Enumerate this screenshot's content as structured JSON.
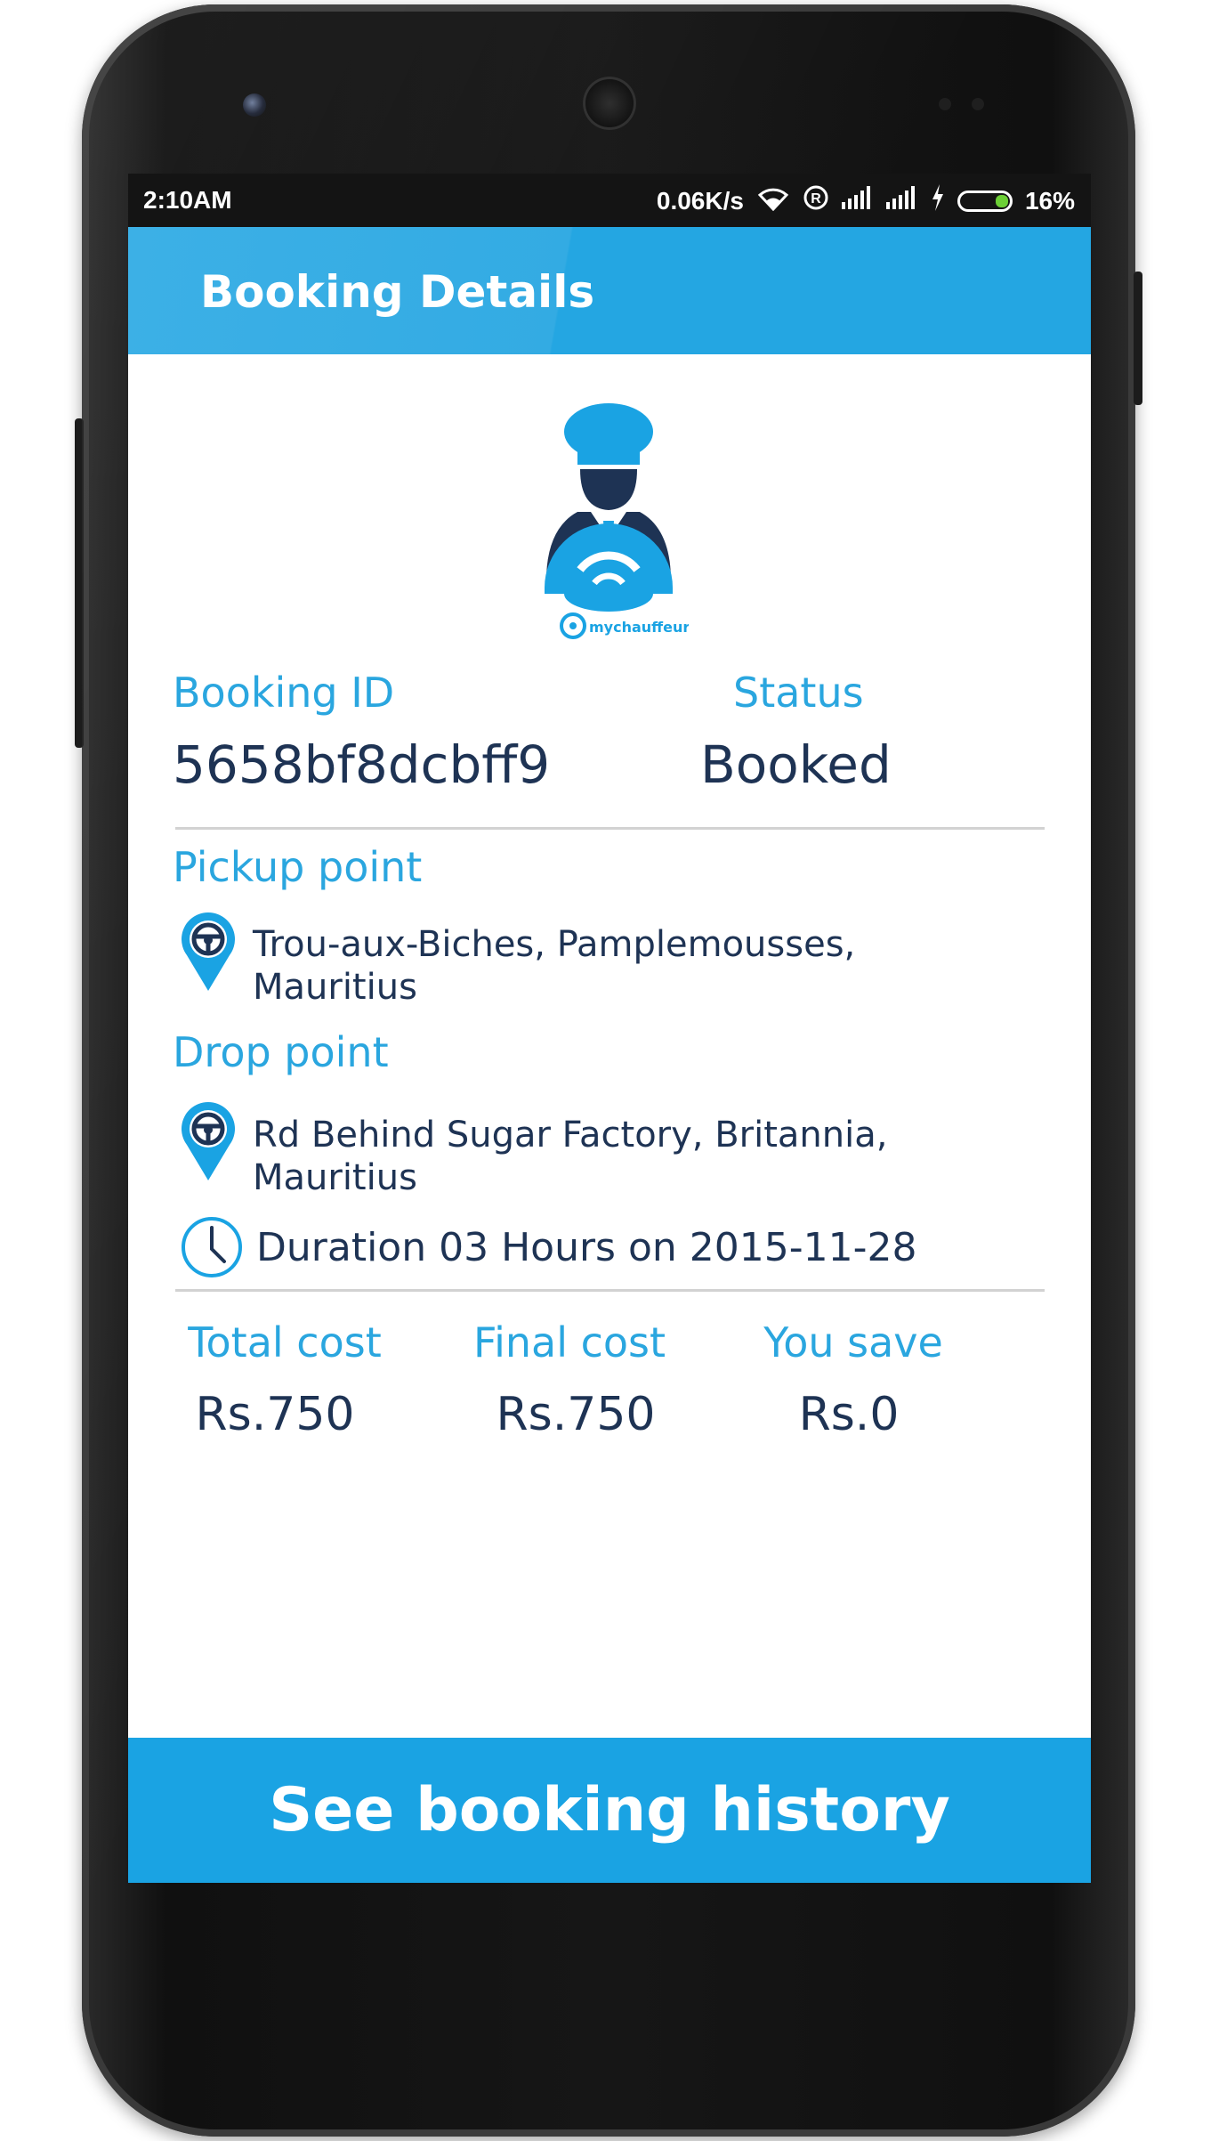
{
  "status_bar": {
    "time": "2:10AM",
    "network_speed": "0.06K/s",
    "battery": "16%",
    "icons": [
      "wifi-icon",
      "registered-icon",
      "signal-icon",
      "signal-icon",
      "charging-icon",
      "battery-icon"
    ]
  },
  "app_bar": {
    "title": "Booking Details"
  },
  "logo": {
    "text": "mychauffeur"
  },
  "booking": {
    "id_label": "Booking ID",
    "id_value": "5658bf8dcbff9",
    "status_label": "Status",
    "status_value": "Booked"
  },
  "pickup": {
    "label": "Pickup point",
    "address_line1": "Trou-aux-Biches, Pamplemousses,",
    "address_line2": "Mauritius"
  },
  "drop": {
    "label": "Drop point",
    "address_line1": "Rd Behind Sugar Factory, Britannia,",
    "address_line2": "Mauritius"
  },
  "duration": {
    "text": "Duration 03 Hours on 2015-11-28"
  },
  "costs": {
    "total_label": "Total cost",
    "total_value": "Rs.750",
    "final_label": "Final cost",
    "final_value": "Rs.750",
    "save_label": "You save",
    "save_value": "Rs.0"
  },
  "footer": {
    "history_button": "See booking history"
  },
  "colors": {
    "accent": "#24a6e2",
    "text_dark": "#1e3354",
    "label_blue": "#2aa6df"
  }
}
